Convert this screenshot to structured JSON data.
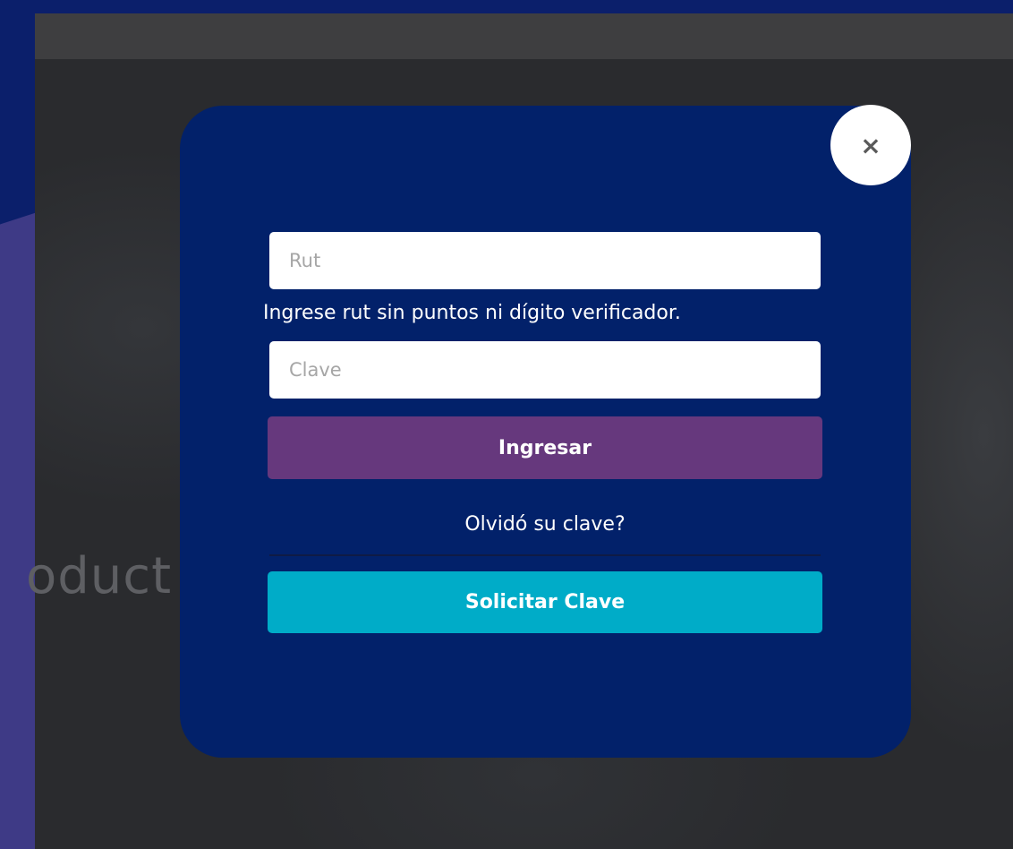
{
  "background": {
    "partial_text": "oduct"
  },
  "modal": {
    "close_symbol": "×",
    "rut_placeholder": "Rut",
    "rut_hint": "Ingrese rut sin puntos ni dígito verificador.",
    "clave_placeholder": "Clave",
    "login_button": "Ingresar",
    "forgot_link": "Olvidó su clave?",
    "request_button": "Solicitar Clave"
  },
  "colors": {
    "page_background": "#0b1f6b",
    "modal_background": "#02216a",
    "login_button": "#66387d",
    "request_button": "#00acc8"
  },
  "icons": {
    "close": "close-icon"
  }
}
